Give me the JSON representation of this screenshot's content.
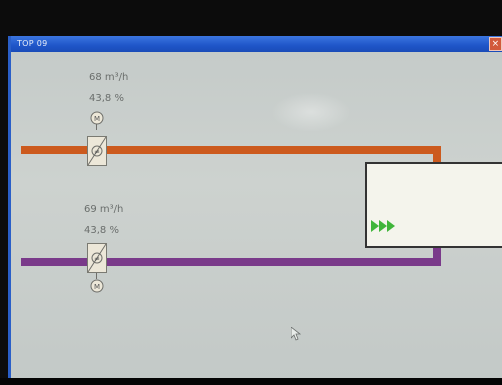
{
  "window": {
    "title": "TOP 09",
    "close_glyph": "×"
  },
  "supply": {
    "flow": "68 m³/h",
    "percent": "43,8 %",
    "duct_color": "#cc5a1e"
  },
  "exhaust": {
    "flow": "69 m³/h",
    "percent": "43,8 %",
    "duct_color": "#7a3a8a"
  },
  "icons": {
    "damper": "damper-icon",
    "motor": "motor-icon",
    "status_arrows": "triple-arrow-icon",
    "cursor": "mouse-cursor-icon"
  },
  "colors": {
    "titlebar": "#1f55c8",
    "status_arrows": "#3fb53a"
  }
}
